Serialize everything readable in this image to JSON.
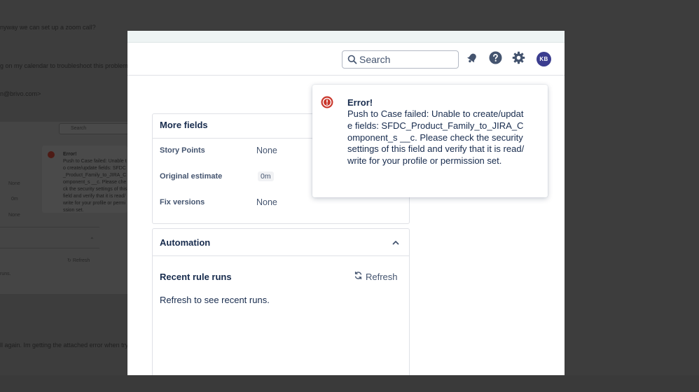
{
  "background": {
    "chat_lines": [
      "nyway we can set up a zoom call?",
      "g on my calendar to troubleshoot this problem e",
      "n@brivo.com>",
      "ll again. Im getting the attached error when try"
    ],
    "thumbnail": {
      "search_placeholder": "Search",
      "error_title": "Error!",
      "error_body": "Push to Case failed: Unable to create/update fields: SFDC_Product_Family_to_JIRA_Component_s __c. Please check the security settings of this field and verify that it is read/write for your profile or permission set.",
      "values": [
        "None",
        "0m",
        "None"
      ],
      "refresh_label": "Refresh",
      "runs_text": "runs."
    }
  },
  "header": {
    "search_placeholder": "Search",
    "icons": [
      "notifications-icon",
      "help-icon",
      "settings-icon"
    ],
    "avatar_initials": "KB",
    "avatar_color": "#3b3d8f"
  },
  "more_fields": {
    "title": "More fields",
    "fields": [
      {
        "label": "Story Points",
        "value": "None"
      },
      {
        "label": "Original estimate",
        "value": "0m"
      },
      {
        "label": "Fix versions",
        "value": "None"
      }
    ]
  },
  "automation": {
    "title": "Automation",
    "section_title": "Recent rule runs",
    "refresh_label": "Refresh",
    "empty_text": "Refresh to see recent runs."
  },
  "error_flag": {
    "title": "Error!",
    "body": "Push to Case failed: Unable to create/update fields: SFDC_Product_Family_to_JIRA_Component_s __c. Please check the security settings of this field and verify that it is read/write for your profile or permission set.",
    "icon_color": "#c9372c"
  }
}
